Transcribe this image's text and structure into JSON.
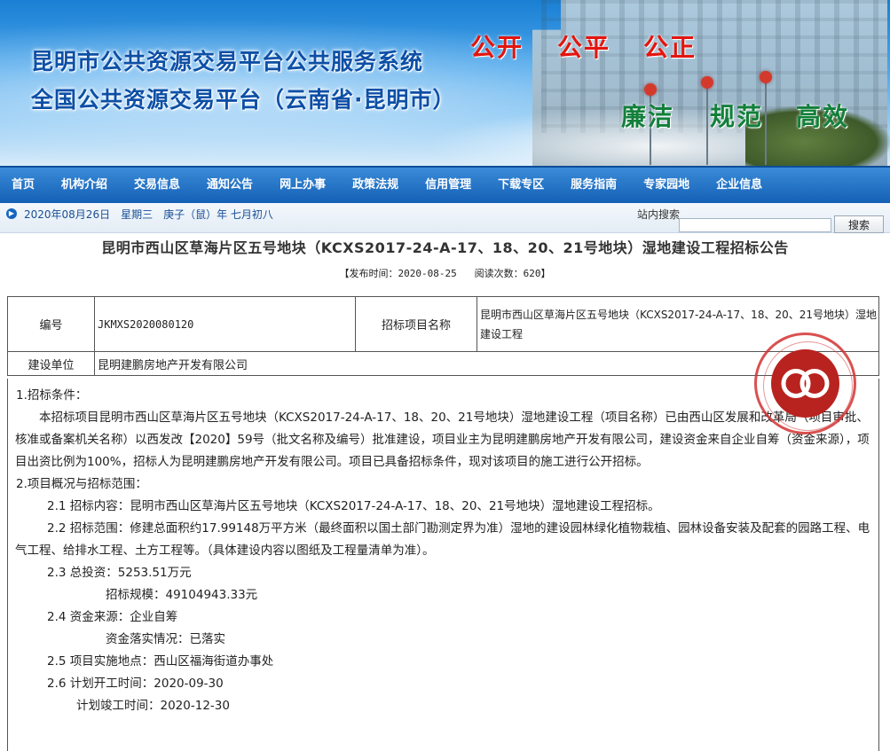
{
  "banner": {
    "title_line1": "昆明市公共资源交易平台公共服务系统",
    "title_line2": "全国公共资源交易平台（云南省·昆明市）",
    "slogan_top": [
      "公开",
      "公平",
      "公正"
    ],
    "slogan_bottom": [
      "廉洁",
      "规范",
      "高效"
    ]
  },
  "nav": {
    "items": [
      "首页",
      "机构介绍",
      "交易信息",
      "通知公告",
      "网上办事",
      "政策法规",
      "信用管理",
      "下载专区",
      "服务指南",
      "专家园地",
      "企业信息"
    ]
  },
  "infobar": {
    "date_text": "2020年08月26日　星期三　庚子（鼠）年 七月初八",
    "search_label": "站内搜索",
    "search_value": "",
    "search_button": "搜索"
  },
  "article": {
    "title": "昆明市西山区草海片区五号地块（KCXS2017-24-A-17、18、20、21号地块）湿地建设工程招标公告",
    "meta_publish_label": "【发布时间：",
    "meta_publish_date": "2020-08-25",
    "meta_views_label": "阅读次数：",
    "meta_views": "620",
    "meta_close": "】"
  },
  "info_table": {
    "number_label": "编号",
    "number_value": "JKMXS2020080120",
    "project_label": "招标项目名称",
    "project_value": "昆明市西山区草海片区五号地块（KCXS2017-24-A-17、18、20、21号地块）湿地建设工程",
    "unit_label": "建设单位",
    "unit_value": "昆明建鹏房地产开发有限公司"
  },
  "body": {
    "s1_heading": "1.招标条件：",
    "s1_para": "本招标项目昆明市西山区草海片区五号地块（KCXS2017-24-A-17、18、20、21号地块）湿地建设工程（项目名称）已由西山区发展和改革局（项目审批、核准或备案机关名称）以西发改【2020】59号（批文名称及编号）批准建设，项目业主为昆明建鹏房地产开发有限公司，建设资金来自企业自筹（资金来源），项目出资比例为100%，招标人为昆明建鹏房地产开发有限公司。项目已具备招标条件，现对该项目的施工进行公开招标。",
    "s2_heading": "2.项目概况与招标范围：",
    "s2_1": "2.1 招标内容：昆明市西山区草海片区五号地块（KCXS2017-24-A-17、18、20、21号地块）湿地建设工程招标。",
    "s2_2": "2.2 招标范围：修建总面积约17.99148万平方米（最终面积以国土部门勘测定界为准）湿地的建设园林绿化植物栽植、园林设备安装及配套的园路工程、电气工程、给排水工程、土方工程等。（具体建设内容以图纸及工程量清单为准）。",
    "s2_3a": "2.3 总投资：5253.51万元",
    "s2_3b": "招标规模：49104943.33元",
    "s2_4a": "2.4 资金来源：企业自筹",
    "s2_4b": "资金落实情况：已落实",
    "s2_5": "2.5 项目实施地点：西山区福海街道办事处",
    "s2_6a": "2.6 计划开工时间：2020-09-30",
    "s2_6b": "计划竣工时间：2020-12-30"
  },
  "colors": {
    "nav_bg": "#1560b5",
    "title_blue": "#0c4fa6",
    "slogan_red": "#e3150f",
    "slogan_green": "#12803a",
    "seal_red": "#b8231f"
  }
}
